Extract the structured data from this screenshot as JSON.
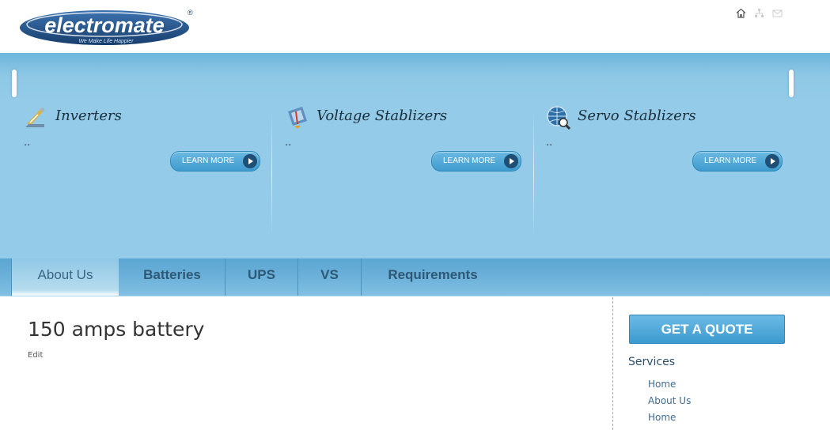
{
  "header": {
    "logo_text": "electromate",
    "logo_tagline": "We Make Life Happier",
    "logo_mark": "®",
    "icons": [
      "home-icon",
      "sitemap-icon",
      "contact-icon"
    ]
  },
  "hero": {
    "panels": [
      {
        "title": "Inverters",
        "text": "..",
        "button": "LEARN MORE",
        "icon": "inverter-icon"
      },
      {
        "title": "Voltage Stablizers",
        "text": "..",
        "button": "LEARN MORE",
        "icon": "voltage-icon"
      },
      {
        "title": "Servo Stablizers",
        "text": "..",
        "button": "LEARN MORE",
        "icon": "servo-icon"
      }
    ]
  },
  "nav": {
    "tabs": [
      {
        "label": "About Us",
        "active": true
      },
      {
        "label": "Batteries",
        "active": false
      },
      {
        "label": "UPS",
        "active": false
      },
      {
        "label": "VS",
        "active": false
      },
      {
        "label": "Requirements",
        "active": false
      }
    ]
  },
  "content": {
    "title": "150 amps battery",
    "edit_label": "Edit"
  },
  "sidebar": {
    "quote_button": "GET A QUOTE",
    "services_title": "Services",
    "services": [
      "Home",
      "About Us",
      "Home"
    ]
  },
  "colors": {
    "hero_blue": "#93cbe8",
    "nav_blue": "#6cb1da",
    "button_blue": "#3f9cce",
    "logo_navy": "#1f4a7d"
  }
}
